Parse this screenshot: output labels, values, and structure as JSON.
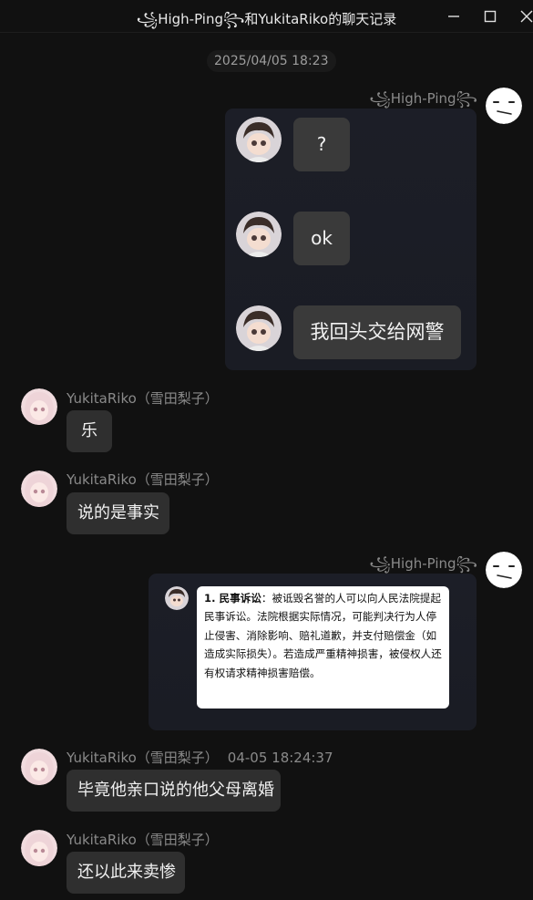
{
  "window": {
    "title": "꧁High-Ping꧂和YukitaRiko的聊天记录",
    "minimize_icon": "minimize-icon",
    "maximize_icon": "maximize-icon",
    "close_icon": "close-icon"
  },
  "chat": {
    "date_separator": "2025/04/05 18:23",
    "messages": [
      {
        "sender": "꧁High-Ping꧂",
        "type": "forwarded-chat",
        "items": [
          "?",
          "ok",
          "我回头交给网警"
        ]
      },
      {
        "sender": "YukitaRiko（雪田梨子）",
        "type": "text",
        "text": "乐"
      },
      {
        "sender": "YukitaRiko（雪田梨子）",
        "type": "text",
        "text": "说的是事实"
      },
      {
        "sender": "꧁High-Ping꧂",
        "type": "forwarded-image",
        "doc_heading": "1. 民事诉讼",
        "doc_body": "：被诋毁名誉的人可以向人民法院提起民事诉讼。法院根据实际情况，可能判决行为人停止侵害、消除影响、赔礼道歉，并支付赔偿金（如造成实际损失）。若造成严重精神损害，被侵权人还有权请求精神损害赔偿。"
      },
      {
        "sender": "YukitaRiko（雪田梨子）",
        "timestamp": "04-05 18:24:37",
        "type": "text",
        "text": "毕竟他亲口说的他父母离婚"
      },
      {
        "sender": "YukitaRiko（雪田梨子）",
        "type": "text",
        "text": "还以此来卖惨"
      }
    ]
  },
  "colors": {
    "background": "#111111",
    "bubble": "#2f2f2f",
    "card": "#1c1e27",
    "sender_text": "#8a8a8a"
  }
}
